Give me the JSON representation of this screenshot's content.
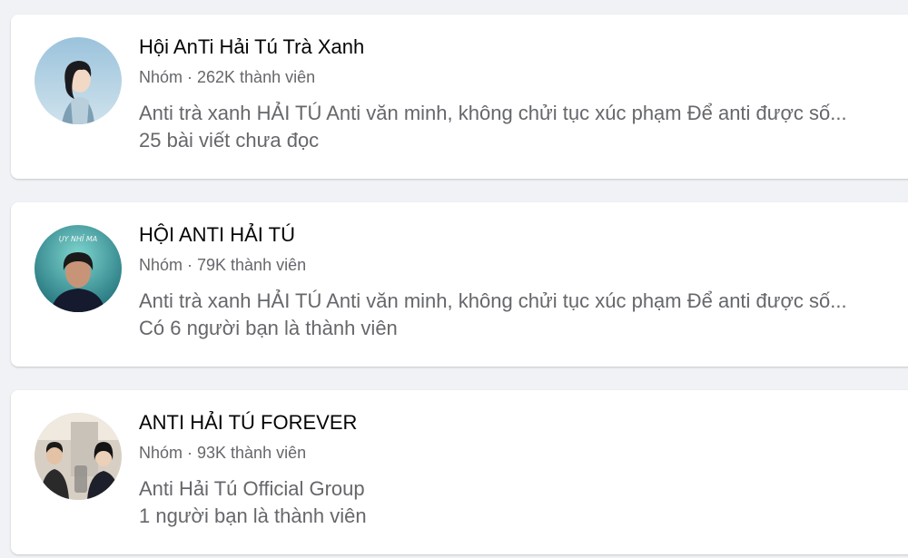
{
  "groups": [
    {
      "name": "Hội AnTi Hải Tú Trà Xanh",
      "meta": "Nhóm · 262K thành viên",
      "description": "Anti trà xanh HẢI TÚ Anti văn minh, không chửi tục xúc phạm Để anti được số...",
      "activity": "25 bài viết chưa đọc",
      "avatar": "woman-profile-photo"
    },
    {
      "name": "HỘI ANTI HẢI TÚ",
      "meta": "Nhóm · 79K thành viên",
      "description": "Anti trà xanh HẢI TÚ Anti văn minh, không chửi tục xúc phạm Để anti được số...",
      "activity": "Có 6 người bạn là thành viên",
      "avatar": "man-teal-background-photo",
      "avatar_text": "ỤY NHỈ MA"
    },
    {
      "name": "ANTI HẢI TÚ FOREVER",
      "meta": "Nhóm · 93K thành viên",
      "description": "Anti Hải Tú Official Group",
      "activity": "1 người bạn là thành viên",
      "avatar": "two-people-photo"
    }
  ],
  "colors": {
    "page_background": "#f0f2f5",
    "card_background": "#ffffff",
    "primary_text": "#050505",
    "secondary_text": "#65676b"
  }
}
